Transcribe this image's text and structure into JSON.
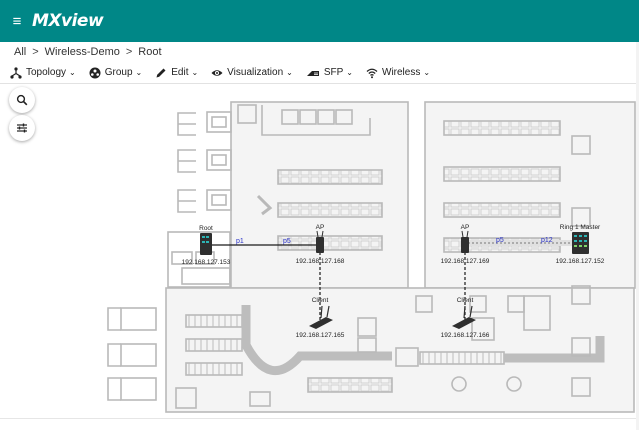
{
  "app": {
    "logo": "MXview",
    "menu_icon": "hamburger-icon"
  },
  "breadcrumb": {
    "items": [
      "All",
      "Wireless-Demo",
      "Root"
    ],
    "separator": ">"
  },
  "toolbar": {
    "items": [
      {
        "label": "Topology",
        "icon": "topology-icon"
      },
      {
        "label": "Group",
        "icon": "group-icon"
      },
      {
        "label": "Edit",
        "icon": "pencil-icon"
      },
      {
        "label": "Visualization",
        "icon": "eye-icon"
      },
      {
        "label": "SFP",
        "icon": "sfp-icon"
      },
      {
        "label": "Wireless",
        "icon": "wifi-icon"
      }
    ]
  },
  "floating": {
    "search_icon": "search-icon",
    "filter_icon": "tune-icon"
  },
  "topology": {
    "devices": [
      {
        "name": "Root",
        "ip": "192.168.127.153",
        "kind": "switch"
      },
      {
        "name": "AP",
        "ip": "192.168.127.168",
        "kind": "ap"
      },
      {
        "name": "Client",
        "ip": "192.168.127.165",
        "kind": "client"
      },
      {
        "name": "AP",
        "ip": "192.168.127.169",
        "kind": "ap"
      },
      {
        "name": "Client",
        "ip": "192.168.127.166",
        "kind": "client"
      },
      {
        "name": "Ring 1 Master",
        "ip": "192.168.127.152",
        "kind": "switch"
      }
    ],
    "ports": [
      "p1",
      "p5",
      "p5",
      "p12"
    ]
  },
  "colors": {
    "header": "#008787",
    "port_label": "#2a33c8",
    "link": "#1a1a1a",
    "floor": "#9a9a9a"
  }
}
